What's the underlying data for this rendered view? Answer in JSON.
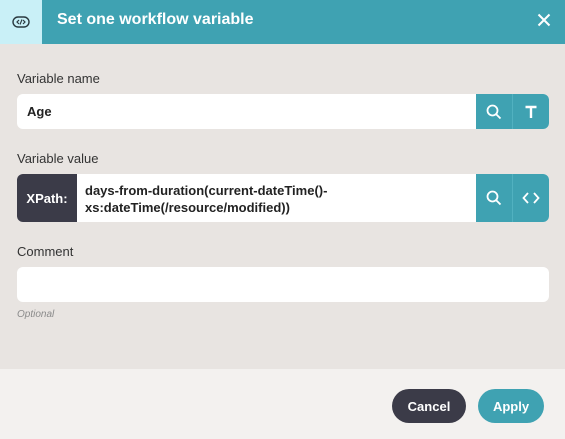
{
  "dialog": {
    "title": "Set one workflow variable"
  },
  "variable_name": {
    "label": "Variable name",
    "value": "Age"
  },
  "variable_value": {
    "label": "Variable value",
    "tag": "XPath:",
    "value": "days-from-duration(current-dateTime()-xs:dateTime(/resource/modified))"
  },
  "comment": {
    "label": "Comment",
    "value": "",
    "hint": "Optional"
  },
  "footer": {
    "cancel_label": "Cancel",
    "apply_label": "Apply"
  },
  "icons": {
    "header": "code-variable-icon",
    "close": "close-icon",
    "search": "search-icon",
    "text_type": "text-type-icon",
    "code": "code-brackets-icon"
  },
  "colors": {
    "accent": "#3fa2b2",
    "dark": "#3b3b48",
    "header_icon_bg": "#c9f0f7",
    "panel_bg": "#e8e4e1"
  }
}
